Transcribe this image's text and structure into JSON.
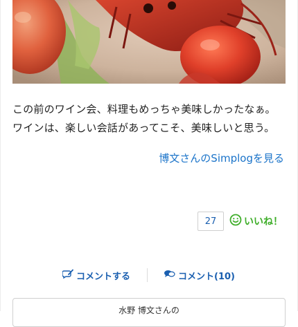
{
  "post": {
    "caption_lines": [
      "この前のワイン会、料理もめっちゃ美味しかったなぁ。",
      "ワインは、楽しい会話があってこそ、美味しいと思う。"
    ],
    "profile_link": "博文さんのSimplogを見る"
  },
  "likes": {
    "count": "27",
    "label": "いいね！",
    "accent": "#3fae2a"
  },
  "actions": {
    "comment_label": "コメントする",
    "comments_count_label": "コメント(10)",
    "link_color": "#1a5fb0"
  },
  "footer": {
    "text": "水野 博文さんの"
  },
  "icons": [
    "smiley-icon",
    "pencil-comment-icon",
    "speech-bubbles-icon"
  ]
}
